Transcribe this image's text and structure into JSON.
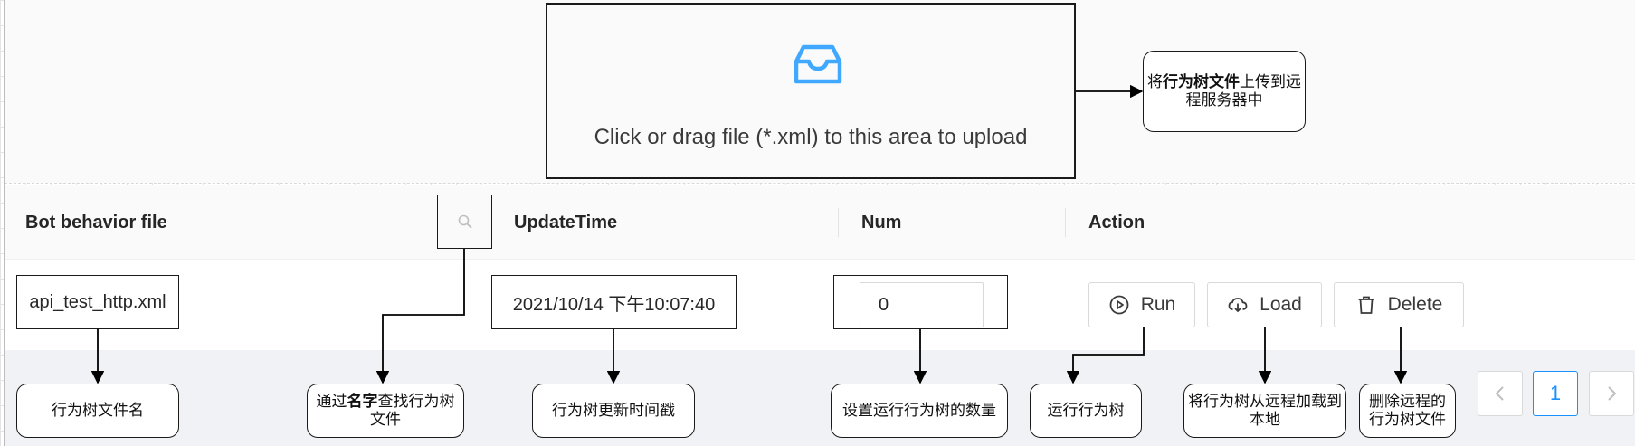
{
  "upload": {
    "hint": "Click or drag file (*.xml) to this area to upload",
    "icon": "inbox-icon",
    "accent_color": "#40a9ff",
    "callout_bold": "行为树文件",
    "callout_pre": "将",
    "callout_post": "上传到远程服务器中"
  },
  "table": {
    "columns": {
      "file": "Bot behavior file",
      "search_icon": "search-icon",
      "update_time": "UpdateTime",
      "num": "Num",
      "action": "Action"
    },
    "row": {
      "file": "api_test_http.xml",
      "update_time": "2021/10/14 下午10:07:40",
      "num": "0"
    },
    "actions": {
      "run": "Run",
      "load": "Load",
      "delete": "Delete"
    }
  },
  "callouts": {
    "file_name": "行为树文件名",
    "search_pre": "通过",
    "search_bold": "名字",
    "search_post": "查找行为树文件",
    "update_time": "行为树更新时间戳",
    "num": "设置运行行为树的数量",
    "run": "运行行为树",
    "load": "将行为树从远程加载到本地",
    "delete": "删除远程的行为树文件"
  },
  "pagination": {
    "prev_icon": "chevron-left-icon",
    "current": "1",
    "next_icon": "chevron-right-icon",
    "active_color": "#1890ff"
  }
}
